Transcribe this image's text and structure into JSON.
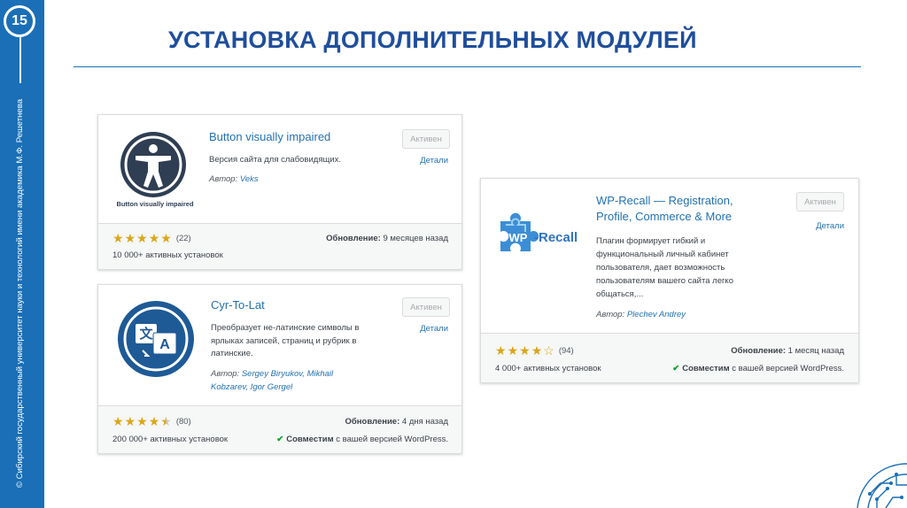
{
  "slide": {
    "number": "15",
    "title": "УСТАНОВКА ДОПОЛНИТЕЛЬНЫХ МОДУЛЕЙ",
    "side_text": "© Сибирский государственный университет науки и технологий имени академика М.Ф. Решетнева"
  },
  "colors": {
    "accent": "#1a6fb7",
    "title": "#1f4e9c",
    "link": "#2271b1",
    "star": "#dba617",
    "check": "#00a32a"
  },
  "plugins": [
    {
      "name": "Button visually impaired",
      "description": "Версия сайта для слабовидящих.",
      "author_label": "Автор:",
      "author": "Veks",
      "icon": "accessibility-person-icon",
      "icon_caption": "Button visually impaired",
      "button_label": "Активен",
      "details_label": "Детали",
      "rating": 5,
      "rating_count": "(22)",
      "installs": "10 000+ активных установок",
      "updated_label": "Обновление:",
      "updated_value": "9 месяцев назад",
      "compat": ""
    },
    {
      "name": "Cyr-To-Lat",
      "description_lines": [
        "Преобразует не-латинские символы в",
        "ярлыках записей, страниц и рубрик в",
        "латинские."
      ],
      "author_label": "Автор:",
      "author_lines": [
        "Sergey Biryukov, Mikhail",
        "Kobzarev, Igor Gergel"
      ],
      "icon": "translate-icon",
      "button_label": "Активен",
      "details_label": "Детали",
      "rating": 4.5,
      "rating_count": "(80)",
      "installs": "200 000+ активных установок",
      "updated_label": "Обновление:",
      "updated_value": "4 дня назад",
      "compat_bold": "Совместим",
      "compat_rest": "с вашей версией WordPress."
    },
    {
      "name_lines": [
        "WP-Recall — Registration,",
        "Profile, Commerce & More"
      ],
      "description_lines": [
        "Плагин формирует гибкий и",
        "функциональный личный кабинет",
        "пользователя, дает возможность",
        "пользователям вашего сайта легко",
        "общаться,..."
      ],
      "author_label": "Автор:",
      "author": "Plechev Andrey",
      "icon": "puzzle-icon",
      "icon_text": "WP-Recall",
      "button_label": "Активен",
      "details_label": "Детали",
      "rating": 4,
      "rating_count": "(94)",
      "installs": "4 000+ активных установок",
      "updated_label": "Обновление:",
      "updated_value": "1 месяц назад",
      "compat_bold": "Совместим",
      "compat_rest": "с вашей версией WordPress."
    }
  ]
}
